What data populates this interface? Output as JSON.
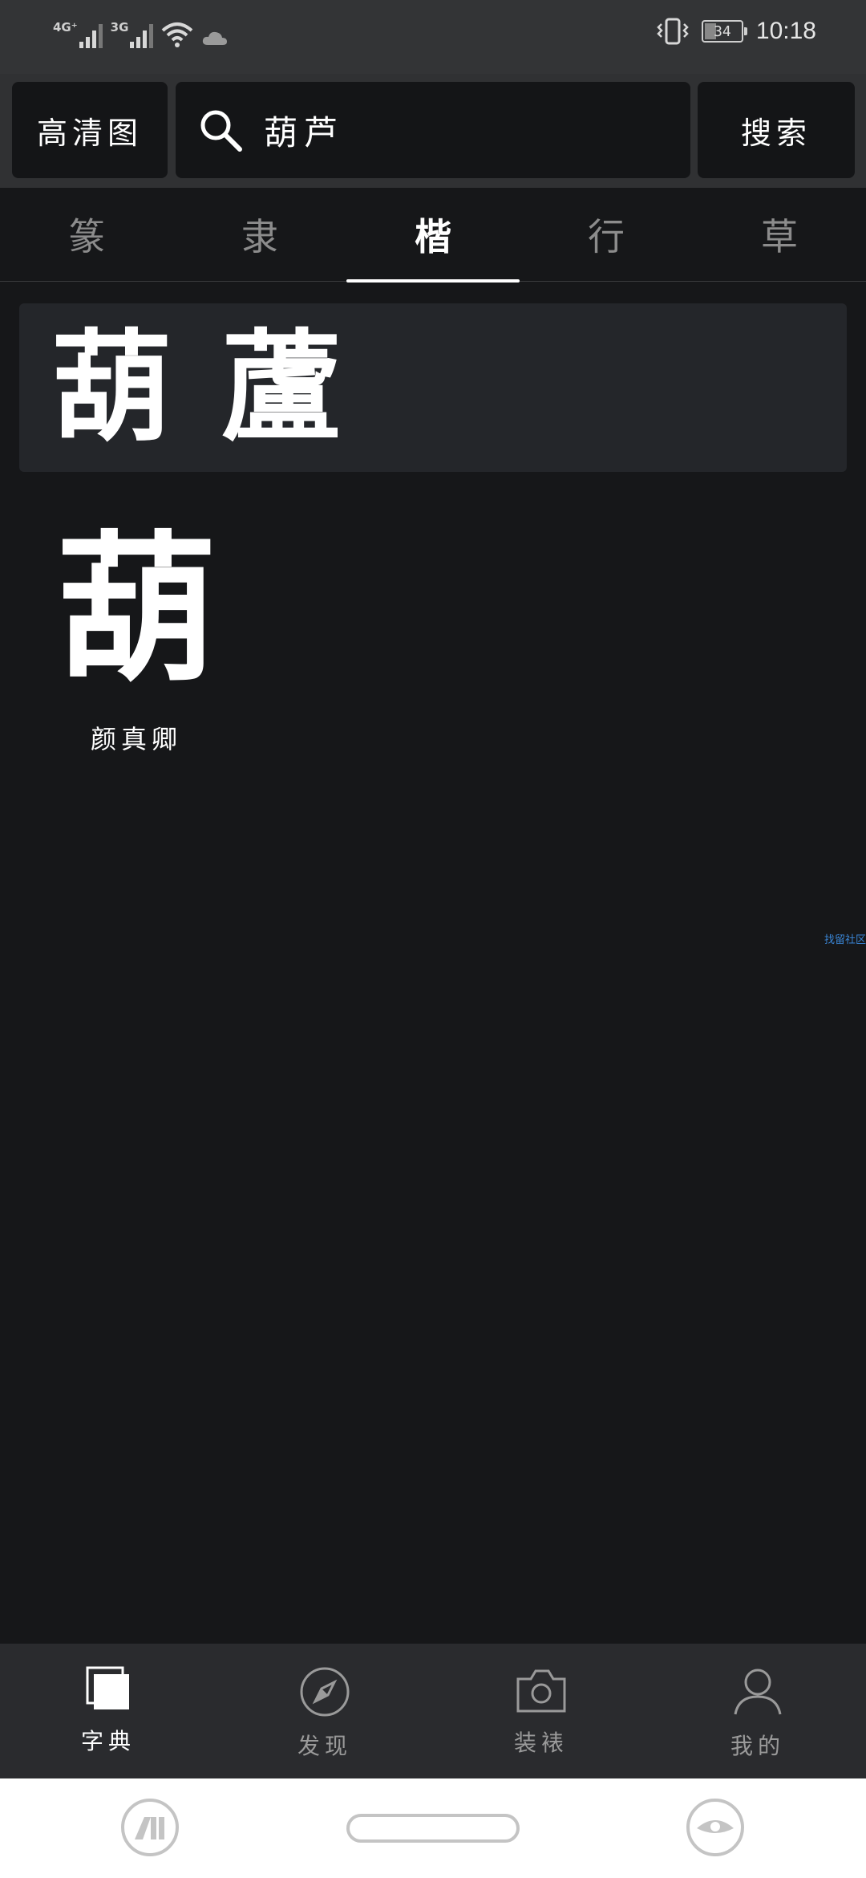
{
  "status_bar": {
    "network_1": "4G⁺",
    "network_2": "3G",
    "battery": "34",
    "time": "10:18"
  },
  "header": {
    "left_button": "高清图",
    "search_value": "葫芦",
    "search_button": "搜索"
  },
  "tabs": [
    {
      "label": "篆"
    },
    {
      "label": "隶"
    },
    {
      "label": "楷"
    },
    {
      "label": "行"
    },
    {
      "label": "草"
    }
  ],
  "result": {
    "chars": [
      "葫",
      "蘆"
    ]
  },
  "glyphs": [
    {
      "char": "葫",
      "author": "颜真卿"
    }
  ],
  "side_link": "找留社区",
  "bottom_nav": [
    {
      "label": "字典",
      "icon": "dictionary-icon"
    },
    {
      "label": "发现",
      "icon": "compass-icon"
    },
    {
      "label": "装裱",
      "icon": "camera-icon"
    },
    {
      "label": "我的",
      "icon": "user-icon"
    }
  ],
  "colors": {
    "background": "#161719",
    "header": "#303133",
    "result_bar": "#24262a",
    "nav": "#2a2b2e",
    "link": "#3a86d6"
  }
}
